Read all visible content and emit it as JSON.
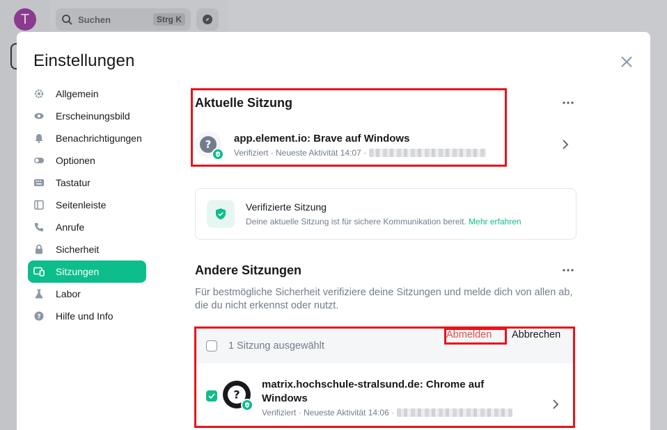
{
  "background": {
    "avatar_letter": "T",
    "search_placeholder": "Suchen",
    "search_shortcut": "Strg K"
  },
  "dialog": {
    "title": "Einstellungen"
  },
  "nav": {
    "items": [
      {
        "label": "Allgemein",
        "icon": "gear-icon"
      },
      {
        "label": "Erscheinungsbild",
        "icon": "eye-icon"
      },
      {
        "label": "Benachrichtigungen",
        "icon": "bell-icon"
      },
      {
        "label": "Optionen",
        "icon": "toggle-icon"
      },
      {
        "label": "Tastatur",
        "icon": "keyboard-icon"
      },
      {
        "label": "Seitenleiste",
        "icon": "sidebar-icon"
      },
      {
        "label": "Anrufe",
        "icon": "phone-icon"
      },
      {
        "label": "Sicherheit",
        "icon": "lock-icon"
      },
      {
        "label": "Sitzungen",
        "icon": "devices-icon",
        "active": true
      },
      {
        "label": "Labor",
        "icon": "flask-icon"
      },
      {
        "label": "Hilfe und Info",
        "icon": "help-icon"
      }
    ]
  },
  "current_session": {
    "heading": "Aktuelle Sitzung",
    "device_name": "app.element.io: Brave auf Windows",
    "meta": "Verifiziert · Neueste Aktivität 14:07 ·"
  },
  "verified_card": {
    "title": "Verifizierte Sitzung",
    "description": "Deine aktuelle Sitzung ist für sichere Kommunikation bereit.",
    "link": "Mehr erfahren"
  },
  "other_sessions": {
    "heading": "Andere Sitzungen",
    "description": "Für bestmögliche Sicherheit verifiziere deine Sitzungen und melde dich von allen ab, die du nicht erkennst oder nutzt.",
    "selection_text": "1 Sitzung ausgewählt",
    "logout_label": "Abmelden",
    "cancel_label": "Abbrechen",
    "device_name_line1": "matrix.hochschule-stralsund.de: Chrome auf",
    "device_name_line2": "Windows",
    "meta": "Verifiziert · Neueste Aktivität 14:06 ·"
  },
  "colors": {
    "accent": "#0dbd8b",
    "danger": "#e0524b",
    "highlight": "#e8131b"
  }
}
